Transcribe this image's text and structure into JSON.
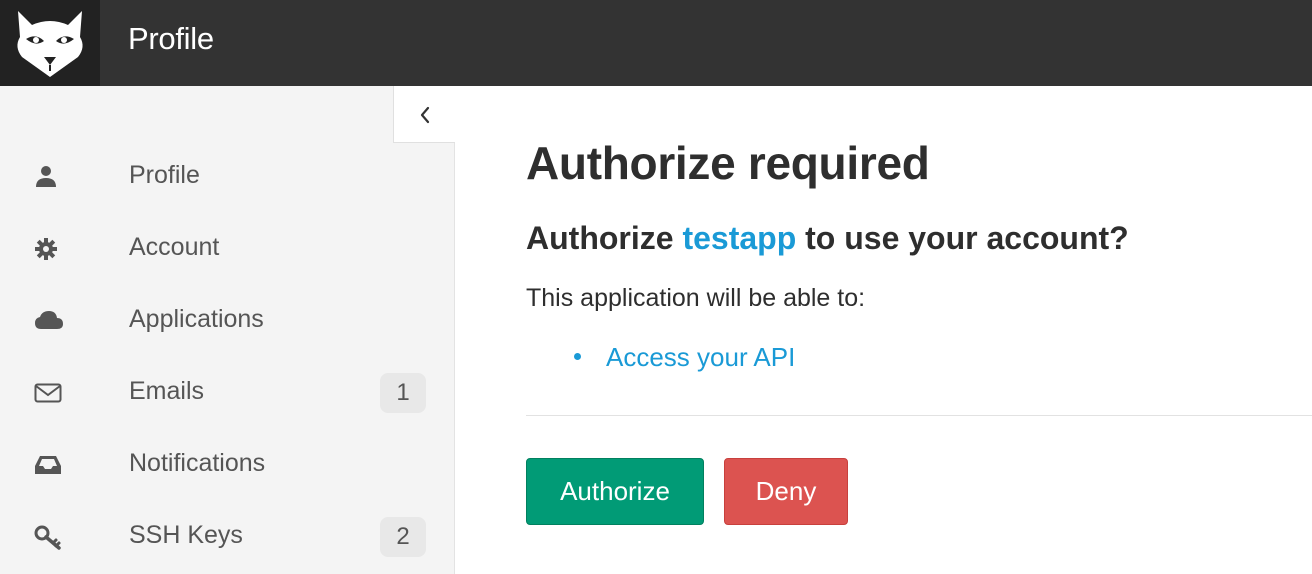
{
  "header": {
    "title": "Profile",
    "logo_icon": "fox-logo-icon"
  },
  "sidebar": {
    "collapse_icon": "chevron-left-icon",
    "items": [
      {
        "label": "Profile",
        "icon": "user-icon",
        "badge": null
      },
      {
        "label": "Account",
        "icon": "gear-icon",
        "badge": null
      },
      {
        "label": "Applications",
        "icon": "cloud-icon",
        "badge": null
      },
      {
        "label": "Emails",
        "icon": "envelope-icon",
        "badge": "1"
      },
      {
        "label": "Notifications",
        "icon": "inbox-icon",
        "badge": null
      },
      {
        "label": "SSH Keys",
        "icon": "key-icon",
        "badge": "2"
      }
    ]
  },
  "main": {
    "title": "Authorize required",
    "question_prefix": "Authorize",
    "app_name": "testapp",
    "question_suffix": "to use your account?",
    "intro": "This application will be able to:",
    "scopes": [
      "Access your API"
    ],
    "authorize_label": "Authorize",
    "deny_label": "Deny"
  },
  "colors": {
    "header_bg": "#333333",
    "logo_bg": "#222222",
    "sidebar_bg": "#f4f4f4",
    "link": "#1a9ad6",
    "authorize_button": "#019b76",
    "deny_button": "#dc5350"
  }
}
